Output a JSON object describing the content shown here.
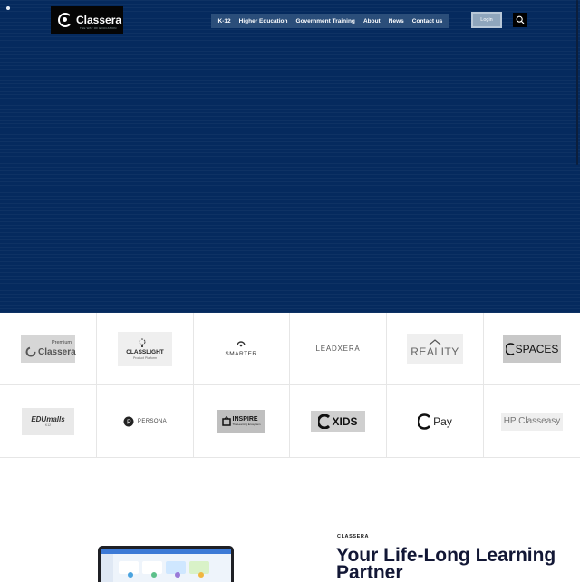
{
  "header": {
    "brand": "Classera",
    "brand_tagline": "THE WAY OF EDUCATION",
    "nav": [
      "K-12",
      "Higher Education",
      "Government Training",
      "About",
      "News",
      "Contact us"
    ],
    "login_label": "Login"
  },
  "partners": {
    "row1": [
      {
        "label_small": "Premium",
        "label": "Classera"
      },
      {
        "label": "CLASSLIGHT",
        "sub": "Product Platform"
      },
      {
        "label": "SMARTER"
      },
      {
        "label": "LEADXERA"
      },
      {
        "label": "REALITY"
      },
      {
        "label": "SPACES"
      }
    ],
    "row2": [
      {
        "label": "EDUmalls",
        "sub": "K12"
      },
      {
        "label": "PERSONA"
      },
      {
        "label": "INSPIRE",
        "sub": "The Learning Ecosystem"
      },
      {
        "label": "XIDS"
      },
      {
        "label": "Pay"
      },
      {
        "label": "HP Classeasy"
      }
    ]
  },
  "about": {
    "eyebrow": "CLASSERA",
    "headline": "Your Life-Long Learning Partner"
  },
  "colors": {
    "hero_bg": "#052a5e",
    "nav_bg": "#2b4e7a",
    "login_bg": "#8fa6bd",
    "headline": "#121735"
  },
  "icons": [
    "search-icon",
    "classera-logo-icon"
  ]
}
